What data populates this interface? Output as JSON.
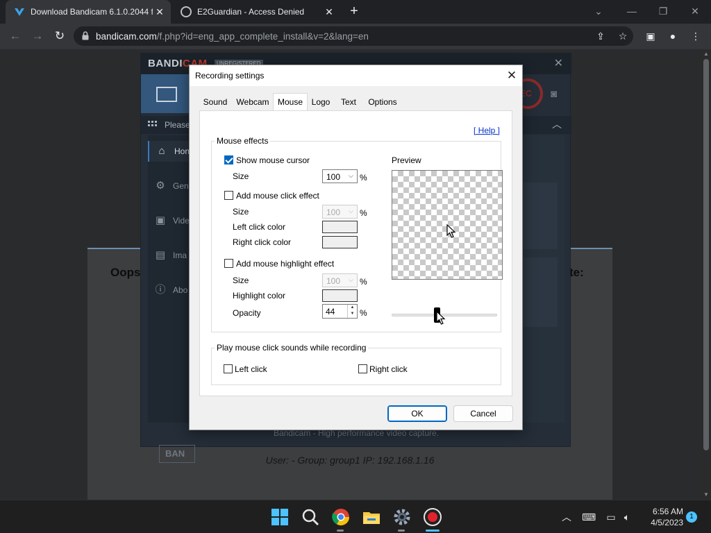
{
  "browser": {
    "tabs": [
      {
        "title": "Download Bandicam 6.1.0.2044 f",
        "active": true
      },
      {
        "title": "E2Guardian - Access Denied",
        "active": false
      }
    ],
    "url_host": "bandicam.com",
    "url_rest": "/f.php?id=eng_app_complete_install&v=2&lang=en"
  },
  "page": {
    "message_left": "Oops",
    "message_right": "te:",
    "user_line": "User: -    Group: group1    IP: 192.168.1.16"
  },
  "bandicam": {
    "logo_a": "BANDI",
    "logo_b": "CAM",
    "unregistered": "UNREGISTERED",
    "rec_label": "EC",
    "banner_text": "Please",
    "sidebar": [
      {
        "label": "Hon",
        "icon": "home-icon",
        "active": true
      },
      {
        "label": "Gen",
        "icon": "gear-icon",
        "active": false
      },
      {
        "label": "Vide",
        "icon": "video-icon",
        "active": false
      },
      {
        "label": "Ima",
        "icon": "image-icon",
        "active": false
      },
      {
        "label": "Abo",
        "icon": "info-icon",
        "active": false
      }
    ],
    "card_text": "e",
    "footer_button": "BAN",
    "status": "Bandicam - High performance video capture."
  },
  "dialog": {
    "title": "Recording settings",
    "tabs": [
      "Sound",
      "Webcam",
      "Mouse",
      "Logo",
      "Text",
      "Options"
    ],
    "selected_tab": "Mouse",
    "help": "[ Help ]",
    "mouse_effects": {
      "group_label": "Mouse effects",
      "show_cursor": {
        "label": "Show mouse cursor",
        "checked": true,
        "size_label": "Size",
        "size": "100",
        "unit": "%"
      },
      "click_effect": {
        "label": "Add mouse click effect",
        "checked": false,
        "size_label": "Size",
        "size": "100",
        "unit": "%",
        "left_label": "Left click color",
        "right_label": "Right click color"
      },
      "highlight_effect": {
        "label": "Add mouse highlight effect",
        "checked": false,
        "size_label": "Size",
        "size": "100",
        "unit": "%",
        "color_label": "Highlight color",
        "opacity_label": "Opacity",
        "opacity": "44",
        "opacity_unit": "%"
      },
      "preview_label": "Preview",
      "opacity_slider_fraction": 0.44
    },
    "sounds": {
      "group_label": "Play mouse click sounds while recording",
      "left": {
        "label": "Left click",
        "checked": false
      },
      "right": {
        "label": "Right click",
        "checked": false
      }
    },
    "ok": "OK",
    "cancel": "Cancel"
  },
  "taskbar": {
    "time": "6:56 AM",
    "date": "4/5/2023",
    "notifications": "1"
  },
  "colors": {
    "accent": "#0067c0",
    "link": "#0033cc",
    "bandicam_rec": "#8a2a2a"
  }
}
